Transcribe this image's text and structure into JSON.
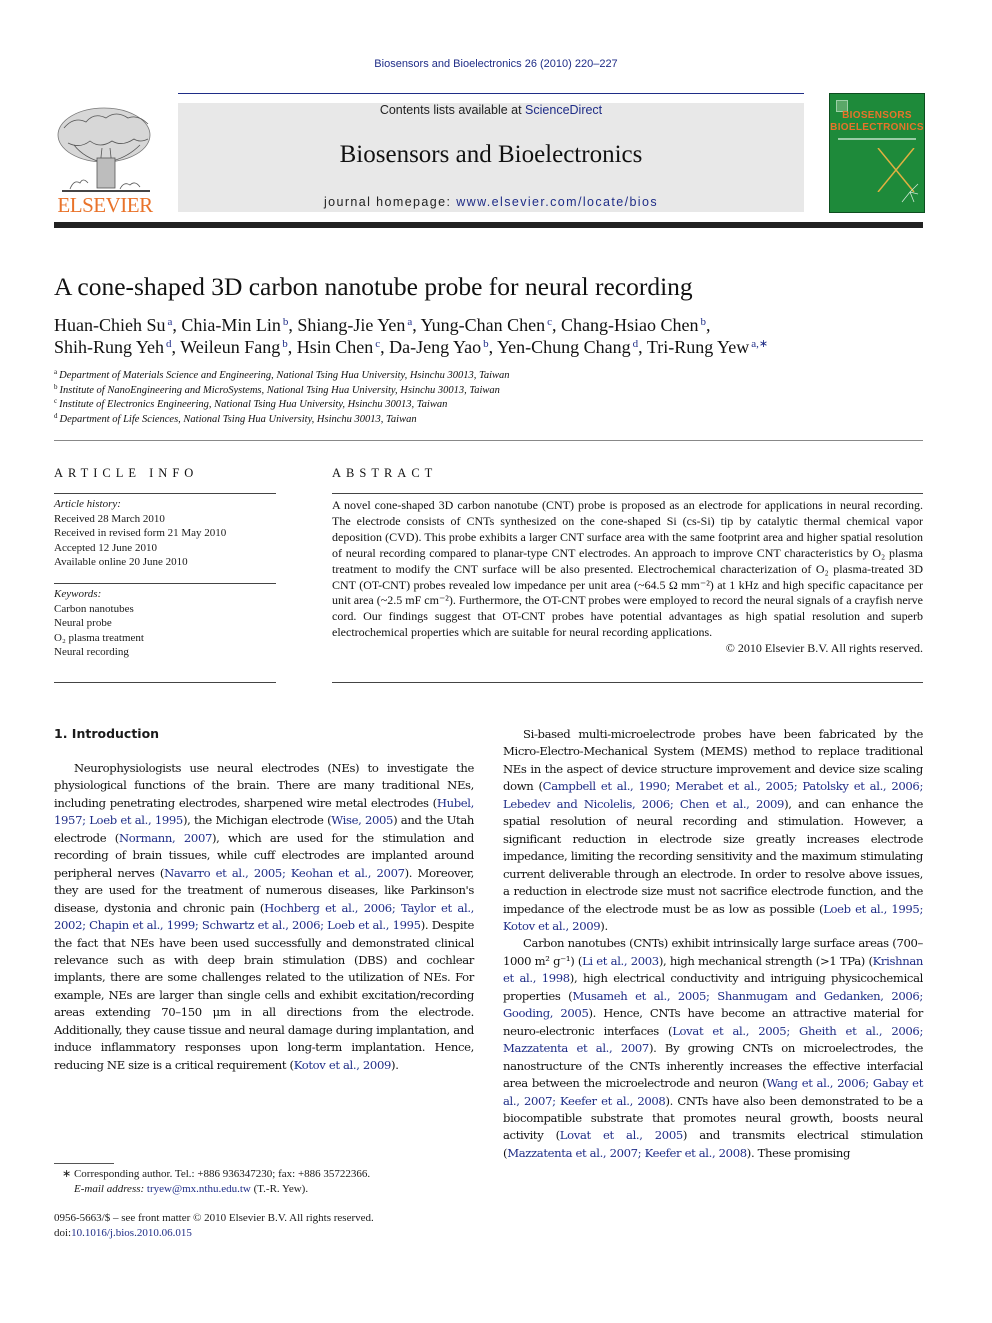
{
  "header": {
    "running_head": "Biosensors and Bioelectronics 26 (2010) 220–227",
    "contents_prefix": "Contents lists available at ",
    "contents_link": "ScienceDirect",
    "journal_title": "Biosensors and Bioelectronics",
    "homepage_prefix": "journal homepage: ",
    "homepage_link": "www.elsevier.com/locate/bios",
    "publisher_logo_text": "ELSEVIER",
    "cover_title_line1": "BIOSENSORS",
    "cover_title_line2": "BIOELECTRONICS",
    "colors": {
      "link": "#1f2d87",
      "elsevier_orange": "#e9732a",
      "cover_green": "#1e8a3a",
      "banner_gray": "#e8e8e8"
    }
  },
  "article": {
    "title": "A cone-shaped 3D carbon nanotube probe for neural recording",
    "authors_line1": [
      {
        "name": "Huan-Chieh Su",
        "aff": "a",
        "sep": ", "
      },
      {
        "name": "Chia-Min Lin",
        "aff": "b",
        "sep": ", "
      },
      {
        "name": "Shiang-Jie Yen",
        "aff": "a",
        "sep": ", "
      },
      {
        "name": "Yung-Chan Chen",
        "aff": "c",
        "sep": ", "
      },
      {
        "name": "Chang-Hsiao Chen",
        "aff": "b",
        "sep": ","
      }
    ],
    "authors_line2": [
      {
        "name": "Shih-Rung Yeh",
        "aff": "d",
        "sep": ", "
      },
      {
        "name": "Weileun Fang",
        "aff": "b",
        "sep": ", "
      },
      {
        "name": "Hsin Chen",
        "aff": "c",
        "sep": ", "
      },
      {
        "name": "Da-Jeng Yao",
        "aff": "b",
        "sep": ", "
      },
      {
        "name": "Yen-Chung Chang",
        "aff": "d",
        "sep": ", "
      },
      {
        "name": "Tri-Rung Yew",
        "aff": "a,∗",
        "sep": ""
      }
    ],
    "affiliations": [
      {
        "key": "a",
        "text": "Department of Materials Science and Engineering, National Tsing Hua University, Hsinchu 30013, Taiwan"
      },
      {
        "key": "b",
        "text": "Institute of NanoEngineering and MicroSystems, National Tsing Hua University, Hsinchu 30013, Taiwan"
      },
      {
        "key": "c",
        "text": "Institute of Electronics Engineering, National Tsing Hua University, Hsinchu 30013, Taiwan"
      },
      {
        "key": "d",
        "text": "Department of Life Sciences, National Tsing Hua University, Hsinchu 30013, Taiwan"
      }
    ]
  },
  "article_info": {
    "label": "ARTICLE INFO",
    "history_label": "Article history:",
    "history": [
      "Received 28 March 2010",
      "Received in revised form 21 May 2010",
      "Accepted 12 June 2010",
      "Available online 20 June 2010"
    ],
    "keywords_label": "Keywords:",
    "keywords": [
      "Carbon nanotubes",
      "Neural probe",
      "O₂ plasma treatment",
      "Neural recording"
    ]
  },
  "abstract": {
    "label": "ABSTRACT",
    "text": "A novel cone-shaped 3D carbon nanotube (CNT) probe is proposed as an electrode for applications in neural recording. The electrode consists of CNTs synthesized on the cone-shaped Si (cs-Si) tip by catalytic thermal chemical vapor deposition (CVD). This probe exhibits a larger CNT surface area with the same footprint area and higher spatial resolution of neural recording compared to planar-type CNT electrodes. An approach to improve CNT characteristics by O₂ plasma treatment to modify the CNT surface will be also presented. Electrochemical characterization of O₂ plasma-treated 3D CNT (OT-CNT) probes revealed low impedance per unit area (~64.5 Ω mm⁻²) at 1 kHz and high specific capacitance per unit area (~2.5 mF cm⁻²). Furthermore, the OT-CNT probes were employed to record the neural signals of a crayfish nerve cord. Our findings suggest that OT-CNT probes have potential advantages as high spatial resolution and superb electrochemical properties which are suitable for neural recording applications.",
    "copyright": "© 2010 Elsevier B.V. All rights reserved."
  },
  "body": {
    "section_heading": "1.  Introduction",
    "left_paragraph": [
      {
        "t": "Neurophysiologists use neural electrodes (NEs) to investigate the physiological functions of the brain. There are many traditional NEs, including penetrating electrodes, sharpened wire metal electrodes ("
      },
      {
        "l": "Hubel, 1957; Loeb et al., 1995"
      },
      {
        "t": "), the Michigan electrode ("
      },
      {
        "l": "Wise, 2005"
      },
      {
        "t": ") and the Utah electrode ("
      },
      {
        "l": "Normann, 2007"
      },
      {
        "t": "), which are used for the stimulation and recording of brain tissues, while cuff electrodes are implanted around peripheral nerves ("
      },
      {
        "l": "Navarro et al., 2005; Keohan et al., 2007"
      },
      {
        "t": "). Moreover, they are used for the treatment of numerous diseases, like Parkinson's disease, dystonia and chronic pain ("
      },
      {
        "l": "Hochberg et al., 2006; Taylor et al., 2002; Chapin et al., 1999; Schwartz et al., 2006; Loeb et al., 1995"
      },
      {
        "t": "). Despite the fact that NEs have been used successfully and demonstrated clinical relevance such as with deep brain stimulation (DBS) and cochlear implants, there are some challenges related to the utilization of NEs. For example, NEs are larger than single cells and exhibit excitation/recording areas extending 70–150 μm in all directions from the electrode. Additionally, they cause tissue and neural damage during implantation, and induce inflammatory responses upon long-term implantation. Hence, reducing NE size is a critical requirement ("
      },
      {
        "l": "Kotov et al., 2009"
      },
      {
        "t": ")."
      }
    ],
    "right_paragraph_1": [
      {
        "t": "Si-based multi-microelectrode probes have been fabricated by the Micro-Electro-Mechanical System (MEMS) method to replace traditional NEs in the aspect of device structure improvement and device size scaling down ("
      },
      {
        "l": "Campbell et al., 1990; Merabet et al., 2005; Patolsky et al., 2006; Lebedev and Nicolelis, 2006; Chen et al., 2009"
      },
      {
        "t": "), and can enhance the spatial resolution of neural recording and stimulation. However, a significant reduction in electrode size greatly increases electrode impedance, limiting the recording sensitivity and the maximum stimulating current deliverable through an electrode. In order to resolve above issues, a reduction in electrode size must not sacrifice electrode function, and the impedance of the electrode must be as low as possible ("
      },
      {
        "l": "Loeb et al., 1995; Kotov et al., 2009"
      },
      {
        "t": ")."
      }
    ],
    "right_paragraph_2": [
      {
        "t": "Carbon nanotubes (CNTs) exhibit intrinsically large surface areas (700–1000 m² g⁻¹) ("
      },
      {
        "l": "Li et al., 2003"
      },
      {
        "t": "), high mechanical strength (>1 TPa) ("
      },
      {
        "l": "Krishnan et al., 1998"
      },
      {
        "t": "), high electrical conductivity and intriguing physicochemical properties ("
      },
      {
        "l": "Musameh et al., 2005; Shanmugam and Gedanken, 2006; Gooding, 2005"
      },
      {
        "t": "). Hence, CNTs have become an attractive material for neuro-electronic interfaces ("
      },
      {
        "l": "Lovat et al., 2005; Gheith et al., 2006; Mazzatenta et al., 2007"
      },
      {
        "t": "). By growing CNTs on microelectrodes, the nanostructure of the CNTs inherently increases the effective interfacial area between the microelectrode and neuron ("
      },
      {
        "l": "Wang et al., 2006; Gabay et al., 2007; Keefer et al., 2008"
      },
      {
        "t": "). CNTs have also been demonstrated to be a biocompatible substrate that promotes neural growth, boosts neural activity ("
      },
      {
        "l": "Lovat et al., 2005"
      },
      {
        "t": ") and transmits electrical stimulation ("
      },
      {
        "l": "Mazzatenta et al., 2007; Keefer et al., 2008"
      },
      {
        "t": "). These promising"
      }
    ]
  },
  "footnote": {
    "marker": "∗",
    "corresponding": "Corresponding author. Tel.: +886 936347230; fax: +886 35722366.",
    "email_label": "E-mail address:",
    "email": "tryew@mx.nthu.edu.tw",
    "email_suffix": " (T.-R. Yew).",
    "front_matter": "0956-5663/$ – see front matter © 2010 Elsevier B.V. All rights reserved.",
    "doi_prefix": "doi:",
    "doi": "10.1016/j.bios.2010.06.015"
  }
}
